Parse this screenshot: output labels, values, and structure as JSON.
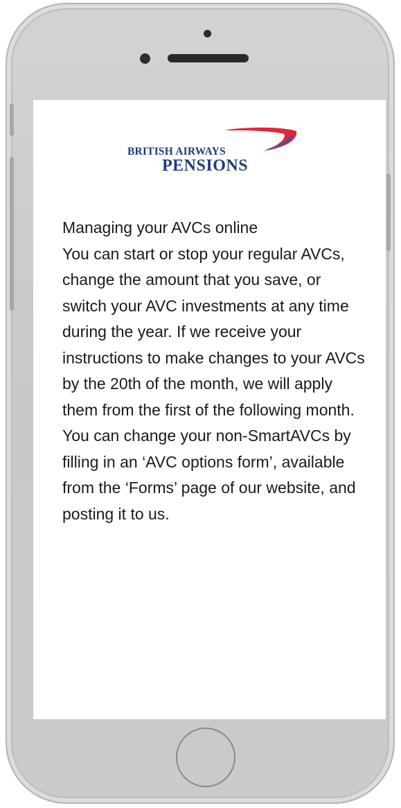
{
  "logo": {
    "line1": "BRITISH AIRWAYS",
    "line2": "PENSIONS",
    "colors": {
      "navy": "#1e3b78",
      "red": "#e32636",
      "blue": "#3a55a4"
    }
  },
  "article": {
    "heading": "Managing your AVCs online",
    "body": "You can start or stop your regular AVCs, change the amount that you save, or switch your AVC investments at any time during the year. If we receive your instructions to make changes to your AVCs by the 20th of the month, we will apply them from the first of the following month. You can change your non-SmartAVCs by filling in an ‘AVC options form’, available from the ‘Forms’ page of our website, and posting it to us."
  },
  "device": {
    "frame_color": "#cfcfcf",
    "screen_color": "#ffffff",
    "icons": [
      "earpiece-icon",
      "front-camera-icon",
      "speaker-grille-icon",
      "home-button-icon"
    ]
  }
}
